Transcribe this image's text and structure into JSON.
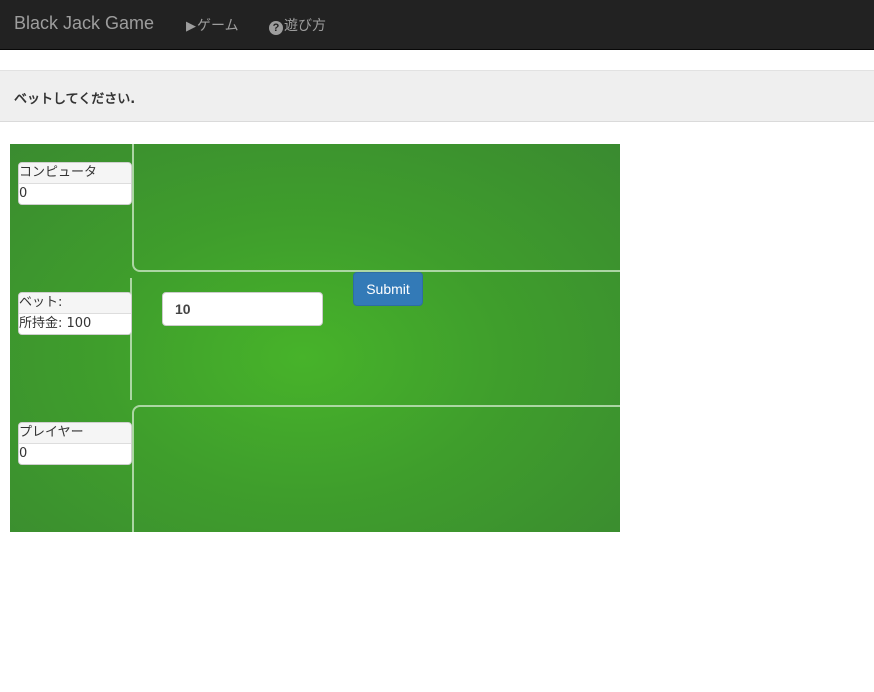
{
  "navbar": {
    "brand": "Black Jack Game",
    "links": [
      {
        "icon": "play-icon",
        "label": "ゲーム"
      },
      {
        "icon": "question-circle-icon",
        "label": "遊び方"
      }
    ]
  },
  "message": "ベットしてください.",
  "table": {
    "computer": {
      "label": "コンピュータ",
      "score": "0"
    },
    "bet": {
      "label": "ベット:",
      "money": "所持金: 100"
    },
    "player": {
      "label": "プレイヤー",
      "score": "0"
    },
    "bet_input_value": "10",
    "submit_label": "Submit"
  },
  "colors": {
    "navbar_bg": "#222222",
    "table_green": "#47b32a",
    "button_primary": "#337ab7"
  }
}
